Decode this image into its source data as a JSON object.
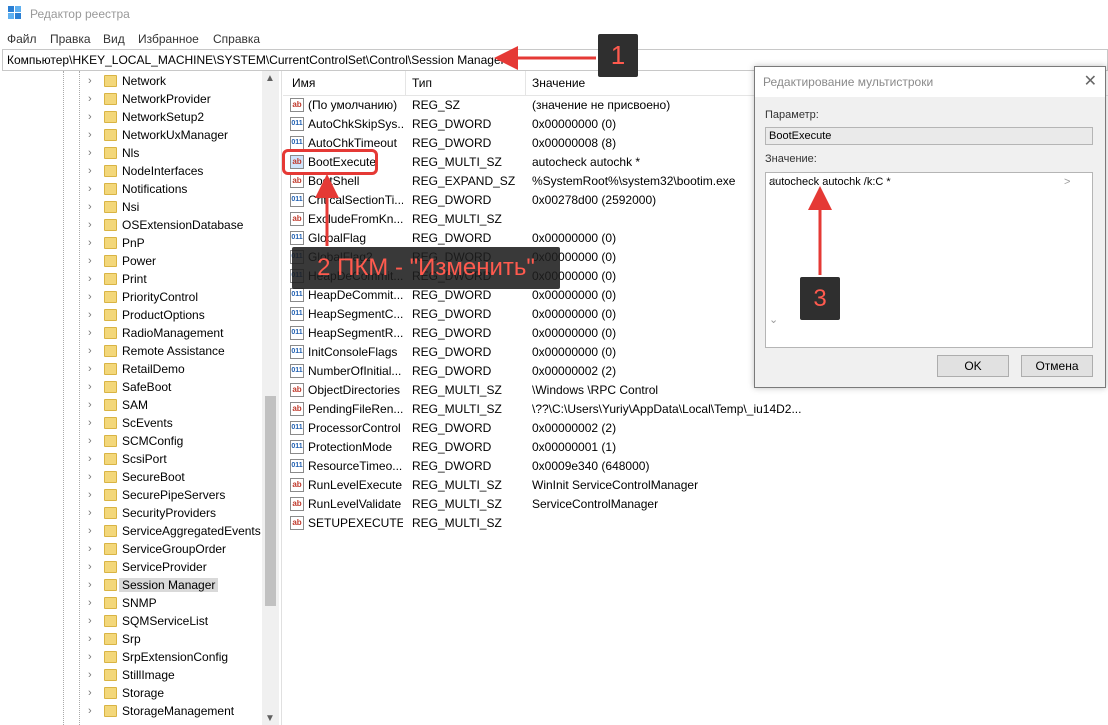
{
  "window": {
    "title": "Редактор реестра"
  },
  "menu": [
    "Файл",
    "Правка",
    "Вид",
    "Избранное",
    "Справка"
  ],
  "address": "Компьютер\\HKEY_LOCAL_MACHINE\\SYSTEM\\CurrentControlSet\\Control\\Session Manager",
  "tree": {
    "items": [
      "Network",
      "NetworkProvider",
      "NetworkSetup2",
      "NetworkUxManager",
      "Nls",
      "NodeInterfaces",
      "Notifications",
      "Nsi",
      "OSExtensionDatabase",
      "PnP",
      "Power",
      "Print",
      "PriorityControl",
      "ProductOptions",
      "RadioManagement",
      "Remote Assistance",
      "RetailDemo",
      "SafeBoot",
      "SAM",
      "ScEvents",
      "SCMConfig",
      "ScsiPort",
      "SecureBoot",
      "SecurePipeServers",
      "SecurityProviders",
      "ServiceAggregatedEvents",
      "ServiceGroupOrder",
      "ServiceProvider",
      "Session Manager",
      "SNMP",
      "SQMServiceList",
      "Srp",
      "SrpExtensionConfig",
      "StillImage",
      "Storage",
      "StorageManagement"
    ],
    "selected": "Session Manager"
  },
  "list": {
    "headers": {
      "name": "Имя",
      "type": "Тип",
      "data": "Значение"
    },
    "rows": [
      {
        "icon": "ab",
        "name": "(По умолчанию)",
        "type": "REG_SZ",
        "data": "(значение не присвоено)"
      },
      {
        "icon": "bin",
        "name": "AutoChkSkipSys...",
        "type": "REG_DWORD",
        "data": "0x00000000 (0)"
      },
      {
        "icon": "bin",
        "name": "AutoChkTimeout",
        "type": "REG_DWORD",
        "data": "0x00000008 (8)"
      },
      {
        "icon": "ab",
        "name": "BootExecute",
        "type": "REG_MULTI_SZ",
        "data": "autocheck autochk *"
      },
      {
        "icon": "ab",
        "name": "BootShell",
        "type": "REG_EXPAND_SZ",
        "data": "%SystemRoot%\\system32\\bootim.exe"
      },
      {
        "icon": "bin",
        "name": "CriticalSectionTi...",
        "type": "REG_DWORD",
        "data": "0x00278d00 (2592000)"
      },
      {
        "icon": "ab",
        "name": "ExcludeFromKn...",
        "type": "REG_MULTI_SZ",
        "data": ""
      },
      {
        "icon": "bin",
        "name": "GlobalFlag",
        "type": "REG_DWORD",
        "data": "0x00000000 (0)"
      },
      {
        "icon": "bin",
        "name": "GlobalFlag2",
        "type": "REG_DWORD",
        "data": "0x00000000 (0)"
      },
      {
        "icon": "bin",
        "name": "HeapDeCommit...",
        "type": "REG_DWORD",
        "data": "0x00000000 (0)"
      },
      {
        "icon": "bin",
        "name": "HeapDeCommit...",
        "type": "REG_DWORD",
        "data": "0x00000000 (0)"
      },
      {
        "icon": "bin",
        "name": "HeapSegmentC...",
        "type": "REG_DWORD",
        "data": "0x00000000 (0)"
      },
      {
        "icon": "bin",
        "name": "HeapSegmentR...",
        "type": "REG_DWORD",
        "data": "0x00000000 (0)"
      },
      {
        "icon": "bin",
        "name": "InitConsoleFlags",
        "type": "REG_DWORD",
        "data": "0x00000000 (0)"
      },
      {
        "icon": "bin",
        "name": "NumberOfInitial...",
        "type": "REG_DWORD",
        "data": "0x00000002 (2)"
      },
      {
        "icon": "ab",
        "name": "ObjectDirectories",
        "type": "REG_MULTI_SZ",
        "data": "\\Windows \\RPC Control"
      },
      {
        "icon": "ab",
        "name": "PendingFileRen...",
        "type": "REG_MULTI_SZ",
        "data": "\\??\\C:\\Users\\Yuriy\\AppData\\Local\\Temp\\_iu14D2..."
      },
      {
        "icon": "bin",
        "name": "ProcessorControl",
        "type": "REG_DWORD",
        "data": "0x00000002 (2)"
      },
      {
        "icon": "bin",
        "name": "ProtectionMode",
        "type": "REG_DWORD",
        "data": "0x00000001 (1)"
      },
      {
        "icon": "bin",
        "name": "ResourceTimeo...",
        "type": "REG_DWORD",
        "data": "0x0009e340 (648000)"
      },
      {
        "icon": "ab",
        "name": "RunLevelExecute",
        "type": "REG_MULTI_SZ",
        "data": "WinInit ServiceControlManager"
      },
      {
        "icon": "ab",
        "name": "RunLevelValidate",
        "type": "REG_MULTI_SZ",
        "data": "ServiceControlManager"
      },
      {
        "icon": "ab",
        "name": "SETUPEXECUTE",
        "type": "REG_MULTI_SZ",
        "data": ""
      }
    ]
  },
  "dialog": {
    "title": "Редактирование мультистроки",
    "param_label": "Параметр:",
    "param_value": "BootExecute",
    "value_label": "Значение:",
    "value_text": "autocheck autochk /k:C *",
    "ok": "OK",
    "cancel": "Отмена"
  },
  "annotations": {
    "step1": "1",
    "step2": "2 ПКМ - \"Изменить\"",
    "step3": "3",
    "color": "#e53935"
  }
}
